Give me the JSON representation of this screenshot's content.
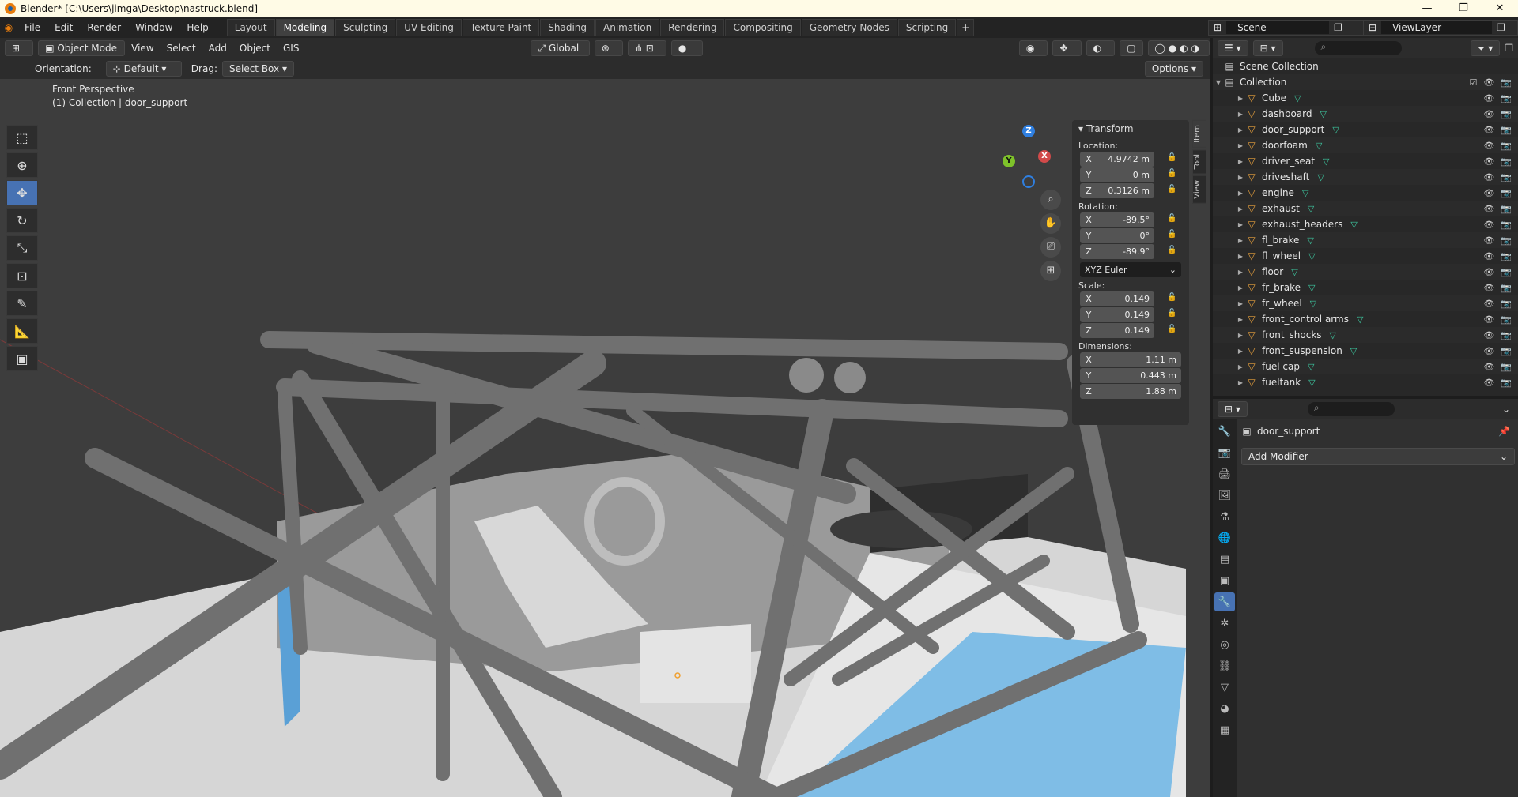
{
  "window": {
    "title": "Blender* [C:\\Users\\jimga\\Desktop\\nastruck.blend]",
    "controls": [
      "—",
      "❐",
      "✕"
    ]
  },
  "menus": [
    "File",
    "Edit",
    "Render",
    "Window",
    "Help"
  ],
  "workspaces": [
    "Layout",
    "Modeling",
    "Sculpting",
    "UV Editing",
    "Texture Paint",
    "Shading",
    "Animation",
    "Rendering",
    "Compositing",
    "Geometry Nodes",
    "Scripting"
  ],
  "active_workspace": "Modeling",
  "scene": "Scene",
  "view_layer": "ViewLayer",
  "viewport": {
    "mode": "Object Mode",
    "menus": [
      "View",
      "Select",
      "Add",
      "Object",
      "GIS"
    ],
    "transform_space": "Global",
    "orientation_label": "Orientation:",
    "orientation_value": "Default",
    "drag_label": "Drag:",
    "drag_value": "Select Box",
    "options": "Options",
    "view_name": "Front Perspective",
    "view_info": "(1) Collection | door_support"
  },
  "gizmo": {
    "z": "Z",
    "y": "Y",
    "x": "X"
  },
  "npanel": {
    "header": "Transform",
    "tabs": [
      "Item",
      "Tool",
      "View"
    ],
    "location_label": "Location:",
    "location": [
      {
        "ax": "X",
        "v": "4.9742 m"
      },
      {
        "ax": "Y",
        "v": "0 m"
      },
      {
        "ax": "Z",
        "v": "0.3126 m"
      }
    ],
    "rotation_label": "Rotation:",
    "rotation": [
      {
        "ax": "X",
        "v": "-89.5°"
      },
      {
        "ax": "Y",
        "v": "0°"
      },
      {
        "ax": "Z",
        "v": "-89.9°"
      }
    ],
    "rotation_mode": "XYZ Euler",
    "scale_label": "Scale:",
    "scale": [
      {
        "ax": "X",
        "v": "0.149"
      },
      {
        "ax": "Y",
        "v": "0.149"
      },
      {
        "ax": "Z",
        "v": "0.149"
      }
    ],
    "dimensions_label": "Dimensions:",
    "dimensions": [
      {
        "ax": "X",
        "v": "1.11 m"
      },
      {
        "ax": "Y",
        "v": "0.443 m"
      },
      {
        "ax": "Z",
        "v": "1.88 m"
      }
    ]
  },
  "outliner": {
    "root": "Scene Collection",
    "collection": "Collection",
    "items": [
      "Cube",
      "dashboard",
      "door_support",
      "doorfoam",
      "driver_seat",
      "driveshaft",
      "engine",
      "exhaust",
      "exhaust_headers",
      "fl_brake",
      "fl_wheel",
      "floor",
      "fr_brake",
      "fr_wheel",
      "front_control arms",
      "front_shocks",
      "front_suspension",
      "fuel cap",
      "fueltank"
    ]
  },
  "properties": {
    "object_name": "door_support",
    "add_modifier": "Add Modifier"
  }
}
